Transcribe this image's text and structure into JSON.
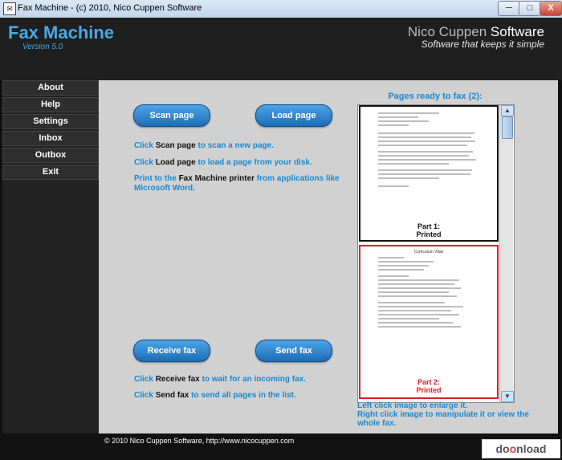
{
  "window": {
    "title": "Fax Machine  -  (c) 2010, Nico Cuppen Software",
    "min": "─",
    "max": "□",
    "close": "X"
  },
  "header": {
    "app_name": "Fax Machine",
    "version": "Version 5.0",
    "vendor_a": "Nico Cuppen",
    "vendor_b": "Software",
    "slogan": "Software that keeps it simple"
  },
  "sidebar": {
    "items": [
      "About",
      "Help",
      "Settings",
      "Inbox",
      "Outbox",
      "Exit"
    ]
  },
  "main": {
    "scan_button": "Scan page",
    "load_button": "Load page",
    "receive_button": "Receive fax",
    "send_button": "Send fax",
    "scan_instr": {
      "pre": "Click ",
      "kw": "Scan page",
      "post": " to scan a new page."
    },
    "load_instr": {
      "pre": "Click ",
      "kw": "Load page",
      "post": " to load a page from your disk."
    },
    "print_instr": {
      "pre": "Print to the ",
      "kw": "Fax Machine printer",
      "post": " from applications like Microsoft Word."
    },
    "receive_instr": {
      "pre": "Click ",
      "kw": "Receive fax",
      "post": " to wait for an incoming fax."
    },
    "send_instr": {
      "pre": "Click ",
      "kw": "Send fax",
      "post": " to send all pages in the list."
    }
  },
  "pages": {
    "title": "Pages ready to fax (2):",
    "items": [
      {
        "part": "Part 1:",
        "status": "Printed"
      },
      {
        "part": "Part 2:",
        "status": "Printed",
        "doc_title": "Curriculum Vitae"
      }
    ],
    "help_line1": "Left click image to enlarge it.",
    "help_line2": "Right click image to manipulate it or view the whole fax."
  },
  "footer": {
    "text": "© 2010 Nico Cuppen Software, http://www.nicocuppen.com"
  },
  "watermark": {
    "a": "do",
    "b": "o",
    "c": "nload"
  }
}
